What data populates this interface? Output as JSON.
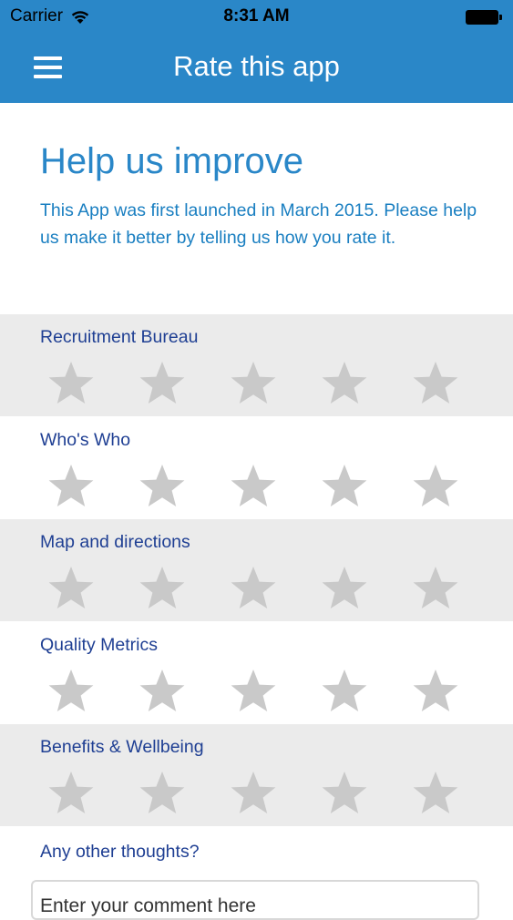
{
  "status_bar": {
    "carrier": "Carrier",
    "time": "8:31 AM"
  },
  "nav": {
    "title": "Rate this app",
    "menu_icon": "hamburger-menu-icon"
  },
  "intro": {
    "heading": "Help us improve",
    "body": "This App was first launched in March 2015. Please help us make it better by telling us how you rate it."
  },
  "ratings": [
    {
      "label": "Recruitment Bureau",
      "stars_selected": 0,
      "stars_total": 5
    },
    {
      "label": "Who's Who",
      "stars_selected": 0,
      "stars_total": 5
    },
    {
      "label": "Map and directions",
      "stars_selected": 0,
      "stars_total": 5
    },
    {
      "label": "Quality Metrics",
      "stars_selected": 0,
      "stars_total": 5
    },
    {
      "label": "Benefits & Wellbeing",
      "stars_selected": 0,
      "stars_total": 5
    }
  ],
  "comments": {
    "label": "Any other thoughts?",
    "placeholder": "Enter your comment here"
  },
  "colors": {
    "header": "#2a87c8",
    "heading_text": "#2a87c8",
    "label_text": "#1f3f93",
    "row_shade": "#ebebeb",
    "star_empty": "#c9c9c9"
  }
}
